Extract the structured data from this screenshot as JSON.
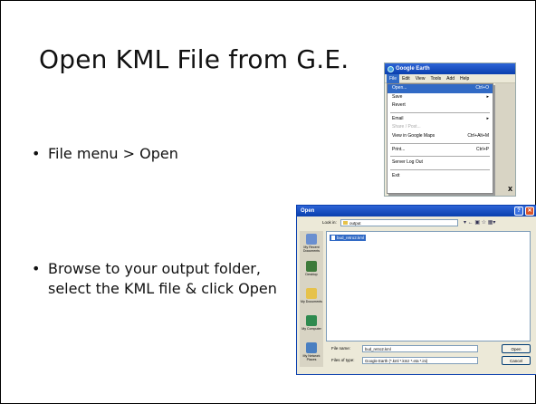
{
  "slide": {
    "title": "Open KML File from G.E.",
    "bullets": [
      {
        "text": "File menu > Open"
      },
      {
        "text": "Browse to your output folder, select the KML file & click Open"
      }
    ]
  },
  "ge_menu": {
    "window_title": "Google Earth",
    "menubar": [
      "File",
      "Edit",
      "View",
      "Tools",
      "Add",
      "Help"
    ],
    "items": [
      {
        "label": "Open...",
        "shortcut": "Ctrl+O"
      },
      {
        "label": "Save",
        "shortcut": "▸"
      },
      {
        "label": "Revert",
        "shortcut": ""
      },
      {
        "label": "Email",
        "shortcut": "▸"
      },
      {
        "label": "Share / Post...",
        "shortcut": ""
      },
      {
        "label": "View in Google Maps",
        "shortcut": "Ctrl+Alt+M"
      },
      {
        "label": "Print...",
        "shortcut": "Ctrl+P"
      },
      {
        "label": "Server Log Out",
        "shortcut": ""
      },
      {
        "label": "Exit",
        "shortcut": ""
      }
    ],
    "close_glyph": "x"
  },
  "open_dialog": {
    "title": "Open",
    "look_in_label": "Look in:",
    "look_in_value": "output",
    "tools": "▾ ← ▣ ☆ ▦▾",
    "places": [
      {
        "label": "My Recent Documents",
        "color": "#6a8fd0"
      },
      {
        "label": "Desktop",
        "color": "#3d7a3a"
      },
      {
        "label": "My Documents",
        "color": "#e6c24a"
      },
      {
        "label": "My Computer",
        "color": "#2e8a4e"
      },
      {
        "label": "My Network Places",
        "color": "#4a7fc1"
      }
    ],
    "file": "bud_retro2.kml",
    "file_name_label": "File name:",
    "file_name_value": "bud_retro2.kml",
    "file_type_label": "Files of type:",
    "file_type_value": "Google Earth (*.kml *.kmz *.eta *.ini)",
    "open_button": "Open",
    "cancel_button": "Cancel"
  }
}
